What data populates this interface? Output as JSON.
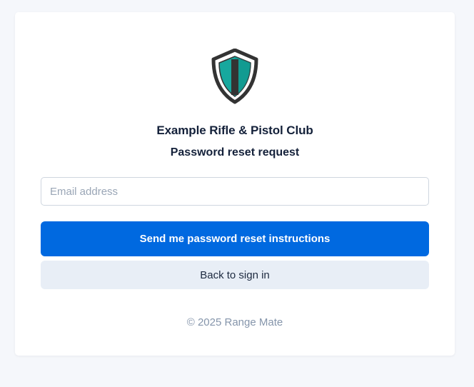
{
  "brand": {
    "logo_icon": "shield-icon",
    "club_name": "Example Rifle & Pistol Club",
    "colors": {
      "shield_outline": "#333333",
      "shield_fill": "#17a89e",
      "accent_blue": "#0069e0"
    }
  },
  "page": {
    "heading": "Password reset request"
  },
  "form": {
    "email_placeholder": "Email address",
    "email_value": "",
    "submit_label": "Send me password reset instructions",
    "back_label": "Back to sign in"
  },
  "footer": {
    "copyright": "© 2025 Range Mate"
  }
}
